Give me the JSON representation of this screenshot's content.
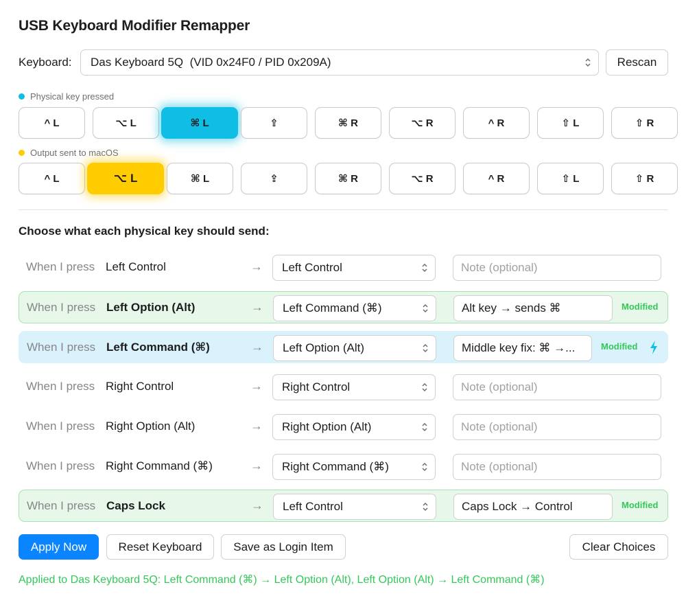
{
  "title": "USB Keyboard Modifier Remapper",
  "keyboard": {
    "label": "Keyboard:",
    "selected": "Das Keyboard 5Q  (VID 0x24F0 / PID 0x209A)",
    "rescan_label": "Rescan"
  },
  "legend_physical": "Physical key pressed",
  "legend_output": "Output sent to macOS",
  "colors": {
    "physical": "#0fbde5",
    "output": "#ffcc00",
    "accent": "#0a84ff",
    "modified": "#34c759"
  },
  "physical_keys": [
    "^ L",
    "⌥ L",
    "⌘ L",
    "⇪",
    "⌘ R",
    "⌥ R",
    "^ R",
    "⇧ L",
    "⇧ R"
  ],
  "physical_active": "⌘ L",
  "output_keys": [
    "^ L",
    "⌥ L",
    "⌘ L",
    "⇪",
    "⌘ R",
    "⌥ R",
    "^ R",
    "⇧ L",
    "⇧ R"
  ],
  "output_active": "⌥ L",
  "section_title": "Choose what each physical key should send:",
  "when_label": "When I press",
  "arrow": "→",
  "note_placeholder": "Note (optional)",
  "modified_label": "Modified",
  "rows": [
    {
      "key": "Left Control",
      "target": "Left Control",
      "note": ""
    },
    {
      "key": "Left Option (Alt)",
      "target": "Left Command (⌘)",
      "note": "Alt key → sends ⌘",
      "modified": true
    },
    {
      "key": "Left Command (⌘)",
      "target": "Left Option (Alt)",
      "note": "Middle key fix: ⌘ →...",
      "modified": true,
      "active": true
    },
    {
      "key": "Right Control",
      "target": "Right Control",
      "note": ""
    },
    {
      "key": "Right Option (Alt)",
      "target": "Right Option (Alt)",
      "note": ""
    },
    {
      "key": "Right Command (⌘)",
      "target": "Right Command (⌘)",
      "note": ""
    },
    {
      "key": "Caps Lock",
      "target": "Left Control",
      "note": "Caps Lock → Control",
      "modified": true
    }
  ],
  "buttons": {
    "apply": "Apply Now",
    "reset": "Reset Keyboard",
    "login": "Save as Login Item",
    "clear": "Clear Choices"
  },
  "status": "Applied to Das Keyboard 5Q: Left Command (⌘) → Left Option (Alt), Left Option (Alt) → Left Command (⌘)"
}
